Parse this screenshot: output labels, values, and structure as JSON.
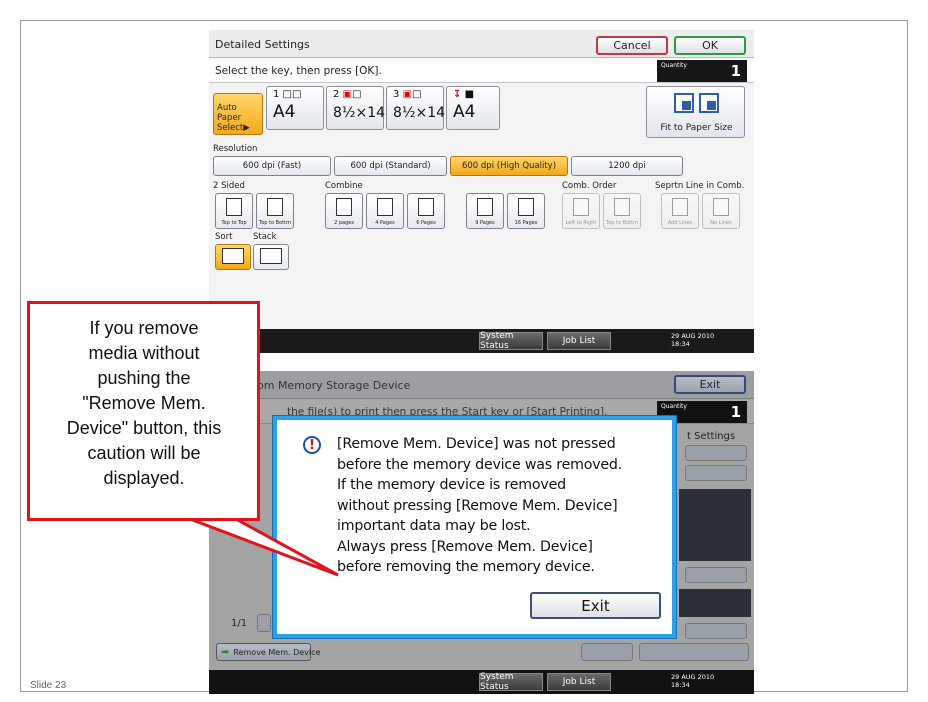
{
  "slide": {
    "number_label": "Slide 23"
  },
  "top_panel": {
    "title": "Detailed Settings",
    "cancel_label": "Cancel",
    "ok_label": "OK",
    "instruction": "Select the key, then press [OK].",
    "quantity_label": "Quantity",
    "quantity_value": "1",
    "paper": {
      "auto_label_line1": "Auto Paper",
      "auto_label_line2": "Select▶",
      "trays": [
        {
          "number": "1",
          "size": "A4"
        },
        {
          "number": "2",
          "size": "8½×14"
        },
        {
          "number": "3",
          "size": "8½×14"
        },
        {
          "number": "",
          "size": "A4"
        }
      ],
      "fit_label": "Fit to Paper Size"
    },
    "resolution": {
      "label": "Resolution",
      "options": [
        "600 dpi (Fast)",
        "600 dpi (Standard)",
        "600 dpi (High Quality)",
        "1200 dpi"
      ],
      "selected": "600 dpi (High Quality)"
    },
    "two_sided": {
      "label": "2 Sided",
      "options": [
        "Top to Top",
        "Top to Bottm"
      ]
    },
    "combine": {
      "label": "Combine",
      "options": [
        "2 pages",
        "4 Pages",
        "6 Pages",
        "9 Pages",
        "16 Pages"
      ]
    },
    "comb_order": {
      "label": "Comb. Order",
      "options": [
        "Left to Right",
        "Top to Bottm"
      ]
    },
    "seprtn_line": {
      "label": "Seprtn Line in Comb.",
      "options": [
        "Add Lines",
        "No Lines"
      ]
    },
    "sort_label": "Sort",
    "stack_label": "Stack",
    "status_bar": {
      "system_status": "System Status",
      "job_list": "Job List",
      "date": "29 AUG 2010",
      "time": "18:34"
    }
  },
  "bottom_panel": {
    "title_partial": "om Memory Storage Device",
    "exit_label": "Exit",
    "instruction_partial": "the file(s) to print then press the Start key or [Start Printing].",
    "quantity_label": "Quantity",
    "quantity_value": "1",
    "print_settings_partial": "t Settings",
    "page_indicator": "1/1",
    "remove_mem_label": "Remove Mem. Device",
    "status_bar": {
      "system_status": "System Status",
      "job_list": "Job List",
      "date": "29 AUG 2010",
      "time": "18:34"
    }
  },
  "dialog": {
    "icon": "warning-icon",
    "message_lines": [
      "[Remove Mem. Device] was not pressed",
      "before the memory device was removed.",
      "If the memory device is removed",
      "without pressing [Remove Mem. Device]",
      "important data may be lost.",
      "Always press [Remove Mem. Device]",
      "before removing the memory device."
    ],
    "exit_label": "Exit"
  },
  "callout": {
    "lines": [
      "If you remove",
      "media without",
      "pushing the",
      "\"Remove Mem.",
      "Device\" button, this",
      "caution will be",
      "displayed."
    ]
  },
  "colors": {
    "callout_border": "#e0141b",
    "dialog_border": "#2ea0e8",
    "selected_key": "#f3a81b"
  }
}
